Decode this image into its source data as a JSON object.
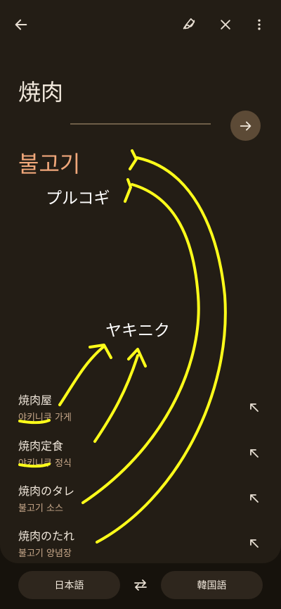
{
  "toolbar": {
    "back_icon": "back-arrow-icon",
    "handwriting_icon": "pen-scribble-icon",
    "close_icon": "close-icon",
    "more_icon": "more-vert-icon"
  },
  "source": {
    "text": "焼肉"
  },
  "translation": {
    "text": "불고기"
  },
  "annotations": {
    "pulgogi": "プルコギ",
    "yakiniku": "ヤキニク"
  },
  "suggestions": [
    {
      "source": "焼肉屋",
      "translation": "야키니쿠 가게"
    },
    {
      "source": "焼肉定食",
      "translation": "야키니쿠 정식"
    },
    {
      "source": "焼肉のタレ",
      "translation": "불고기 소스"
    },
    {
      "source": "焼肉のたれ",
      "translation": "불고기 양념장"
    }
  ],
  "languages": {
    "source": "日本語",
    "target": "韓国語"
  },
  "colors": {
    "background": "#16120c",
    "panel": "#231d15",
    "accent_translation": "#f0a77a",
    "annotation_stroke": "#ffff1a",
    "go_button": "#5c4a36"
  }
}
